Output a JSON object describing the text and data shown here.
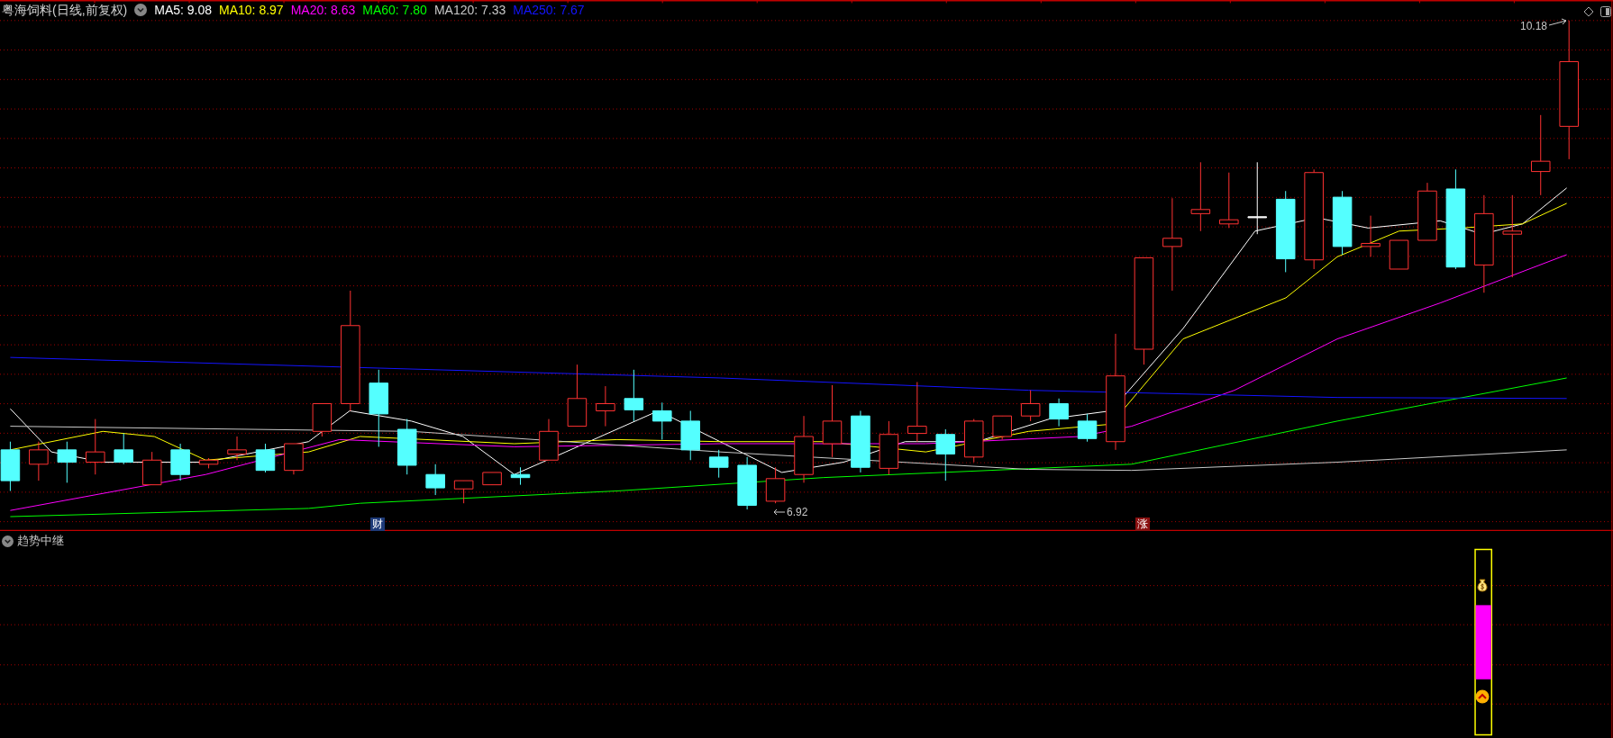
{
  "chart": {
    "title": "粤海饲料(日线,前复权)",
    "moving_averages": [
      {
        "label": "MA5: 9.08",
        "color": "#ffffff"
      },
      {
        "label": "MA10: 8.97",
        "color": "#ffff00"
      },
      {
        "label": "MA20: 8.63",
        "color": "#ff00ff"
      },
      {
        "label": "MA60: 7.80",
        "color": "#00ff00"
      },
      {
        "label": "MA120: 7.33",
        "color": "#c8c8c8"
      },
      {
        "label": "MA250: 7.67",
        "color": "#1414ff"
      }
    ],
    "high_label": "10.18",
    "low_label": "6.92",
    "markers": [
      {
        "text": "财",
        "kind": "finance"
      },
      {
        "text": "涨",
        "kind": "limit-up"
      }
    ]
  },
  "indicator": {
    "title": "趋势中继"
  }
}
